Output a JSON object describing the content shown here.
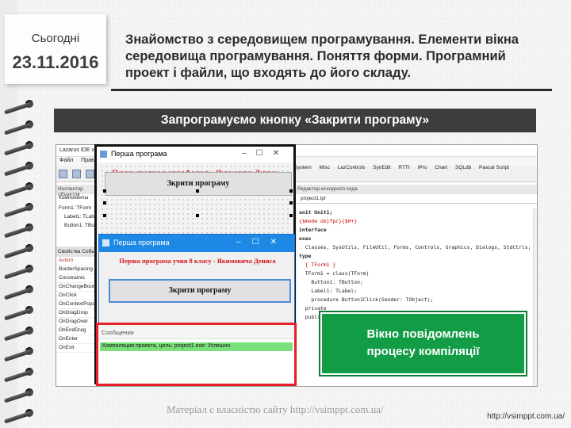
{
  "date_tag": {
    "today": "Сьогодні",
    "date": "23.11.2016"
  },
  "title": "Знайомство з середовищем програмування. Елементи вікна середовища програмування. Поняття форми. Програмний проект і файли, що входять до його складу.",
  "banner": "Запрограмуємо кнопку «Закрити програму»",
  "ide": {
    "title": "Lazarus IDE v1.6 - project1",
    "menu": [
      "Файл",
      "Правка"
    ],
    "component_tabs": [
      "System",
      "Misc",
      "LazControls",
      "SynEdit",
      "RTTI",
      "IPro",
      "Chart",
      "SQLdb",
      "Pascal Script"
    ],
    "inspector_title": "Инспектор объектов",
    "inspector_components": "Компоненты",
    "tree": [
      "Form1: TForm",
      "Label1: TLabel",
      "Button1: TButton"
    ],
    "prop_tabs": [
      "Свойства",
      "События"
    ],
    "events": [
      "Action",
      "BorderSpacing",
      "Constraints",
      "OnChangeBounds",
      "OnClick",
      "OnContextPopup",
      "OnDragDrop",
      "OnDragOver",
      "OnEndDrag",
      "OnEnter",
      "OnExit"
    ],
    "editor_title": "Редактор исходного кода",
    "editor_tab": "project1.lpr",
    "code": [
      "unit Unit1;",
      "",
      "{$mode objfpc}{$H+}",
      "",
      "interface",
      "",
      "uses",
      "  Classes, SysUtils, FileUtil, Forms, Controls, Graphics, Dialogs, StdCtrls;",
      "",
      "type",
      "",
      "  { TForm1 }",
      "",
      "  TForm1 = class(TForm)",
      "    Button1: TButton;",
      "    Label1: TLabel;",
      "    procedure Button1Click(Sender: TObject);",
      "  private",
      "  public"
    ]
  },
  "designer": {
    "window_title": "Перша програма",
    "label_text": "Перша програма учня 8 класу - Якимовича Дениса",
    "button_text": "Зкрити програму"
  },
  "runform": {
    "window_title": "Перша програма",
    "label_text": "Перша програма учня 8 класу - Якимовича Дениса",
    "button_text": "Зкрити програму"
  },
  "messages": {
    "header": "Сообщения",
    "line": "Компиляция проекта, цель: project1.exe: Успешно"
  },
  "callout": [
    "Вікно повідомлень",
    "процесу компіляції"
  ],
  "footer": {
    "note": "Матеріал є власністю сайту http://vsimppt.com.ua/",
    "url": "http://vsimppt.com.ua/"
  },
  "colors": {
    "banner": "#3d3d3d",
    "callout": "#129c45",
    "highlight": "#e8202a",
    "success": "#7be07b",
    "label_red": "#d4141c"
  }
}
